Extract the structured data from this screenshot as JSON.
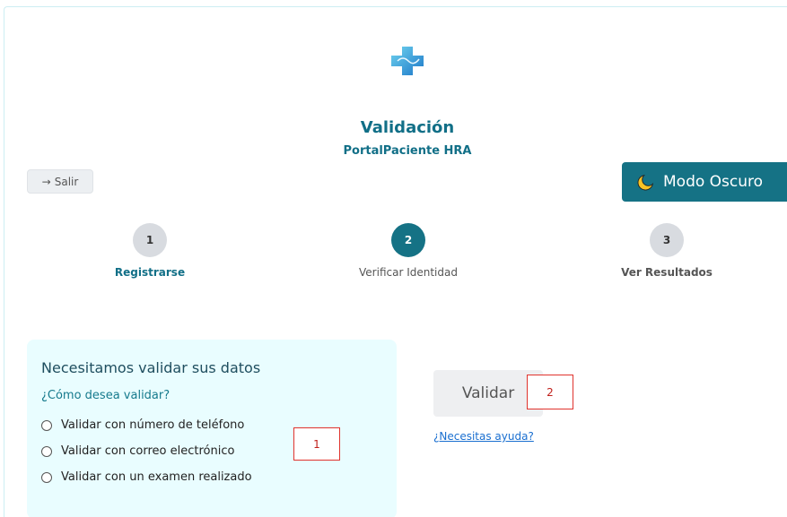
{
  "header": {
    "title": "Validación",
    "subtitle": "PortalPaciente HRA",
    "logo_icon": "medical-cross-logo",
    "exit_label": "Salir",
    "exit_icon": "arrow-right-icon",
    "dark_mode_label": "Modo Oscuro",
    "dark_mode_icon": "moon-icon"
  },
  "steps": [
    {
      "number": "1",
      "label": "Registrarse",
      "state": "completed"
    },
    {
      "number": "2",
      "label": "Verificar Identidad",
      "state": "active"
    },
    {
      "number": "3",
      "label": "Ver Resultados",
      "state": "pending"
    }
  ],
  "card": {
    "title": "Necesitamos validar sus datos",
    "question": "¿Cómo desea validar?",
    "options": [
      "Validar con número de teléfono",
      "Validar con correo electrónico",
      "Validar con un examen realizado"
    ]
  },
  "actions": {
    "validate_label": "Validar",
    "help_link": "¿Necesitas ayuda?"
  },
  "annotations": {
    "box1": "1",
    "box2": "2"
  },
  "colors": {
    "accent": "#157285",
    "title": "#116f87",
    "card_bg": "#e9fdff",
    "annotation": "#e0332d"
  }
}
